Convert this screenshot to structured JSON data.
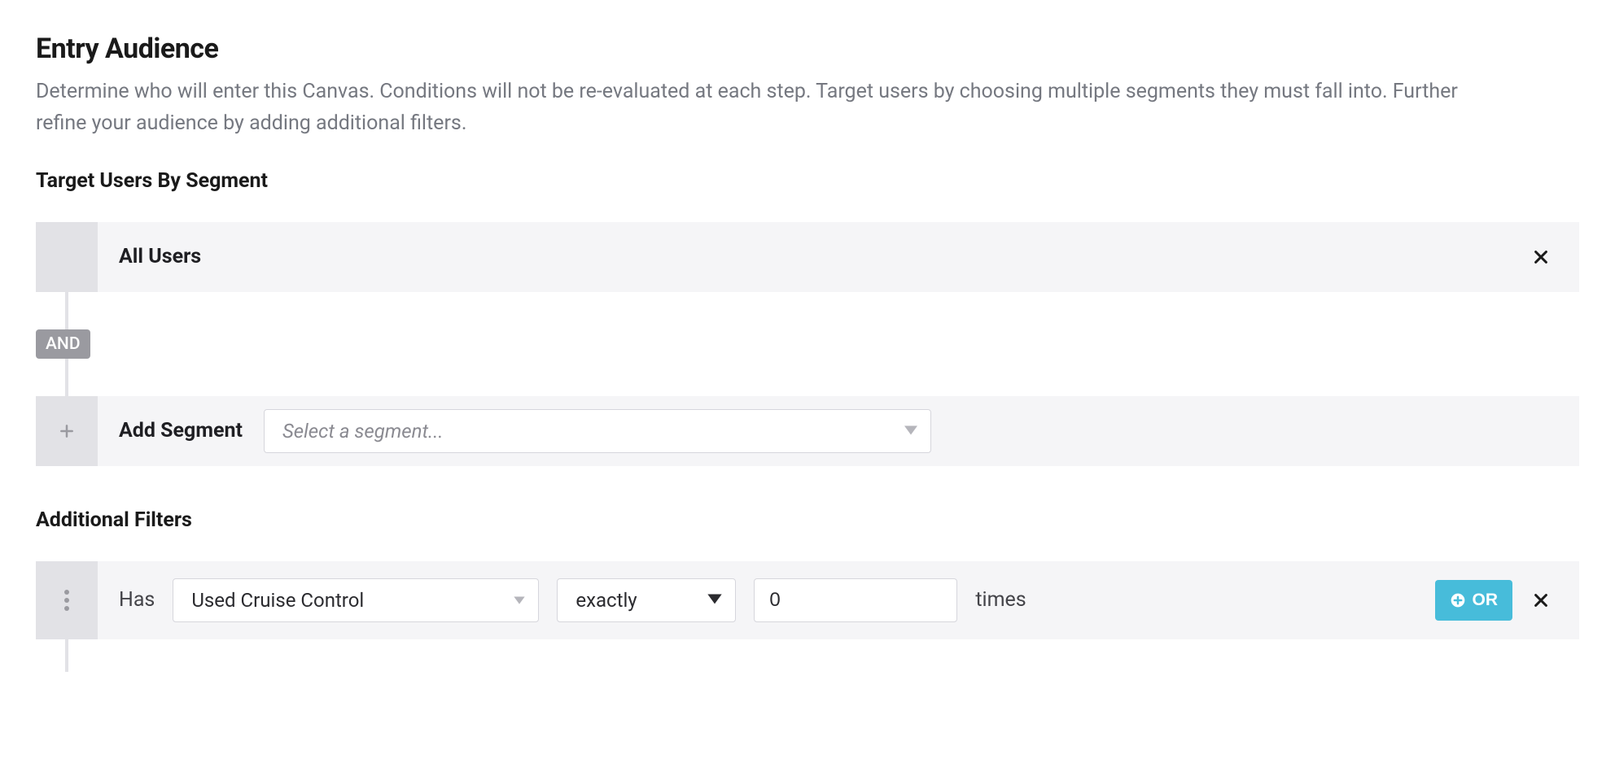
{
  "header": {
    "title": "Entry Audience",
    "description": "Determine who will enter this Canvas. Conditions will not be re-evaluated at each step. Target users by choosing multiple segments they must fall into. Further refine your audience by adding additional filters."
  },
  "segments": {
    "heading": "Target Users By Segment",
    "rows": [
      {
        "label": "All Users"
      }
    ],
    "connector_label": "AND",
    "add": {
      "label": "Add Segment",
      "placeholder": "Select a segment..."
    }
  },
  "filters": {
    "heading": "Additional Filters",
    "row": {
      "prefix": "Has",
      "event": "Used Cruise Control",
      "comparator": "exactly",
      "count": "0",
      "suffix": "times",
      "or_label": "OR"
    }
  }
}
